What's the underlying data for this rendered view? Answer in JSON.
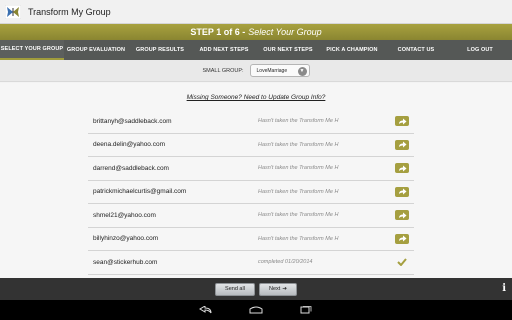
{
  "app": {
    "title": "Transform My Group"
  },
  "step": {
    "label": "STEP 1 of 6 -",
    "subtitle": "Select Your Group"
  },
  "tabs": [
    {
      "label": "SELECT YOUR GROUP",
      "active": true
    },
    {
      "label": "GROUP EVALUATION",
      "active": false
    },
    {
      "label": "GROUP RESULTS",
      "active": false
    },
    {
      "label": "ADD NEXT STEPS",
      "active": false
    },
    {
      "label": "OUR NEXT STEPS",
      "active": false
    },
    {
      "label": "PICK A CHAMPION",
      "active": false
    },
    {
      "label": "CONTACT US",
      "active": false
    },
    {
      "label": "LOG OUT",
      "active": false
    }
  ],
  "group": {
    "label": "SMALL GROUP:",
    "selected": "LoveMarriage"
  },
  "missing_link": "Missing Someone? Need to Update Group Info?",
  "members": [
    {
      "email": "brittanyh@saddleback.com",
      "status": "Hasn't taken the Transform Me H",
      "action": "forward"
    },
    {
      "email": "deena.delin@yahoo.com",
      "status": "Hasn't taken the Transform Me H",
      "action": "forward"
    },
    {
      "email": "darrend@saddleback.com",
      "status": "Hasn't taken the Transform Me H",
      "action": "forward"
    },
    {
      "email": "patrickmichaelcurtis@gmail.com",
      "status": "Hasn't taken the Transform Me H",
      "action": "forward"
    },
    {
      "email": "shmel21@yahoo.com",
      "status": "Hasn't taken the Transform Me H",
      "action": "forward"
    },
    {
      "email": "billyhinzo@yahoo.com",
      "status": "Hasn't taken the Transform Me H",
      "action": "forward"
    },
    {
      "email": "sean@stickerhub.com",
      "status": "completed 01/20/2014",
      "action": "check"
    }
  ],
  "buttons": {
    "send_all": "Send all",
    "next": "Next"
  },
  "colors": {
    "accent": "#a59f40",
    "tabbar": "#555856",
    "bottom": "#333333"
  },
  "icons": {
    "app": "butterfly-icon",
    "info": "info-icon",
    "nav": [
      "back-icon",
      "home-icon",
      "recent-apps-icon"
    ]
  }
}
